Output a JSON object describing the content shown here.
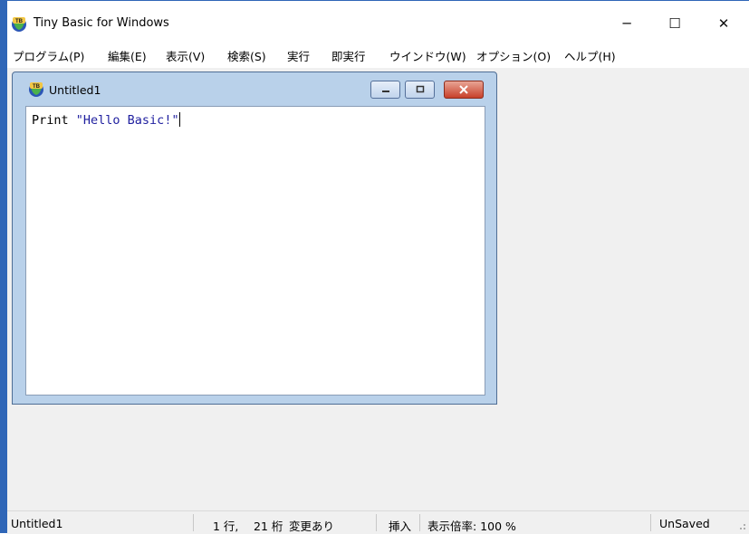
{
  "window": {
    "title": "Tiny Basic for Windows",
    "min": "─",
    "max": "☐",
    "close": "✕"
  },
  "menu": [
    "プログラム(P)",
    "編集(E)",
    "表示(V)",
    "検索(S)",
    "実行",
    "即実行",
    "ウインドウ(W)",
    "オプション(O)",
    "ヘルプ(H)"
  ],
  "child": {
    "title": "Untitled1",
    "code_keyword": "Print ",
    "code_string": "\"Hello Basic!\""
  },
  "status": {
    "name": "Untitled1",
    "line": "1 行,",
    "col": "21 桁",
    "modified": "変更あり",
    "mode": "挿入",
    "zoom": "表示倍率: 100 %",
    "saved": "UnSaved"
  },
  "colors": {
    "frame": "#2f66b7",
    "code_string": "#1f1f9f"
  }
}
